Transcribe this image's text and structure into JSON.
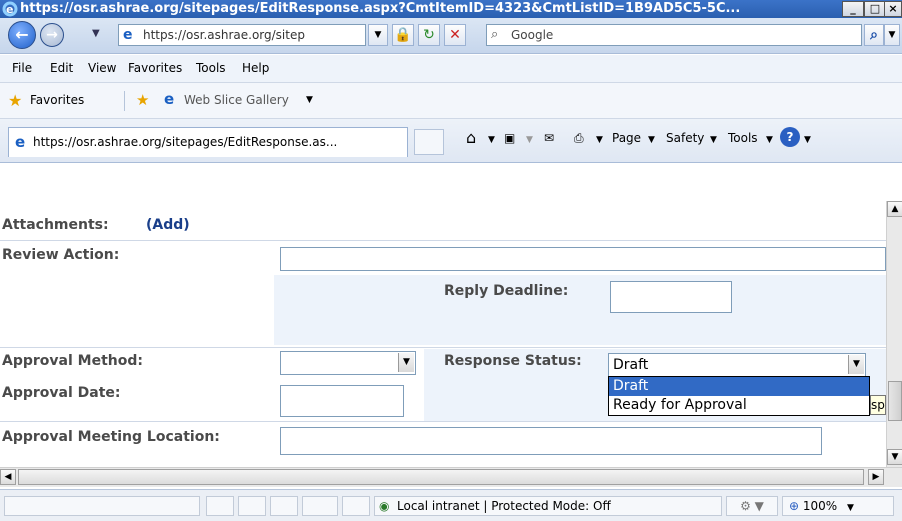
{
  "window": {
    "title": "https://osr.ashrae.org/sitepages/EditResponse.aspx?CmtItemID=4323&CmtListID=1B9AD5C5-5C..."
  },
  "address": {
    "url": "https://osr.ashrae.org/sitep",
    "search_placeholder": "Google"
  },
  "menu": [
    "File",
    "Edit",
    "View",
    "Favorites",
    "Tools",
    "Help"
  ],
  "favorites": {
    "label": "Favorites",
    "web_slice": "Web Slice Gallery"
  },
  "tab": {
    "title": "https://osr.ashrae.org/sitepages/EditResponse.as..."
  },
  "commands": {
    "page": "Page",
    "safety": "Safety",
    "tools": "Tools"
  },
  "form": {
    "attachments_label": "Attachments:",
    "add_link": "(Add)",
    "review_action_label": "Review Action:",
    "reply_deadline_label": "Reply Deadline:",
    "approval_method_label": "Approval Method:",
    "response_status_label": "Response Status:",
    "response_status_value": "Draft",
    "response_status_options": [
      "Draft",
      "Ready for Approval"
    ],
    "approval_date_label": "Approval Date:",
    "approval_meeting_location_label": "Approval Meeting Location:",
    "tooltip_fragment": "spon"
  },
  "status": {
    "zone": "Local intranet | Protected Mode: Off",
    "zoom": "100%"
  }
}
